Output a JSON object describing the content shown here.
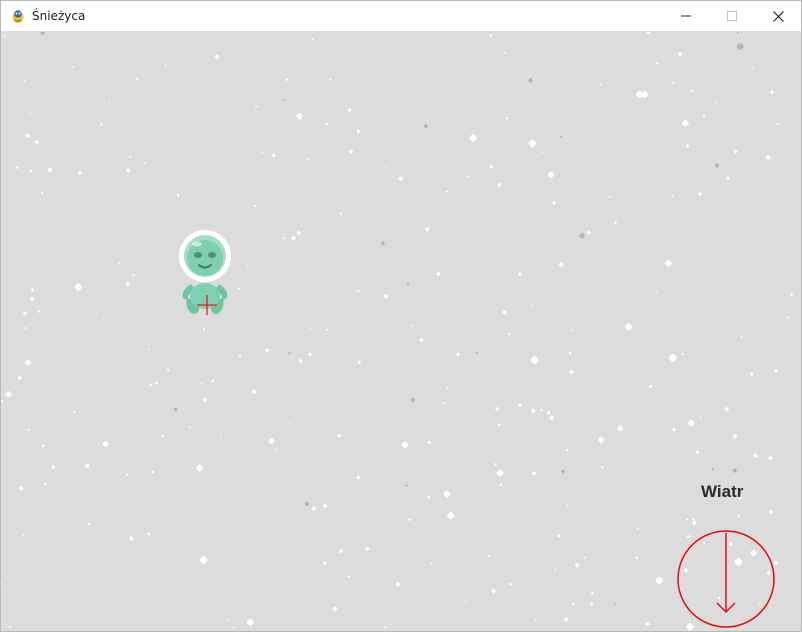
{
  "window": {
    "title": "Śnieżyca",
    "icon": "pygame-snake-icon",
    "controls": {
      "minimize": "minimize-icon",
      "maximize": "maximize-icon",
      "close": "close-icon"
    }
  },
  "game": {
    "background_color": "#dcdcdc",
    "snow_color": "#ffffff",
    "far_snow_color": "#b4b4b4",
    "player": {
      "sprite": "astronaut-alien",
      "color": "#7fcfb0",
      "crosshair_color": "#e02020"
    },
    "wind": {
      "label": "Wiatr",
      "indicator_color": "#e01010",
      "direction": "down"
    }
  }
}
